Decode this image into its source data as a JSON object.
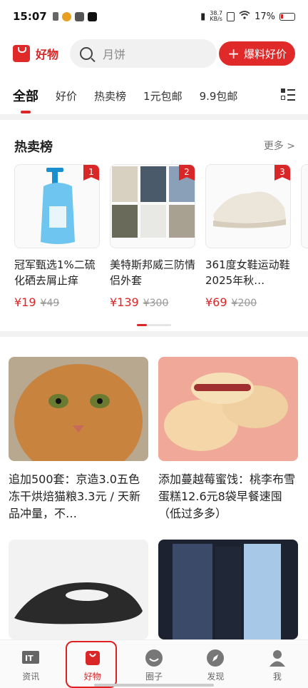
{
  "status": {
    "time": "15:07",
    "speed": "38.7",
    "speed_unit": "KB/s",
    "battery": "17%"
  },
  "header": {
    "logo_text": "好物",
    "search_placeholder": "月饼",
    "tip_button": "爆料好价"
  },
  "tabs": [
    "全部",
    "好价",
    "热卖榜",
    "1元包邮",
    "9.9包邮"
  ],
  "hot": {
    "title": "热卖榜",
    "more": "更多 >",
    "items": [
      {
        "rank": "1",
        "name": "冠军甄选1%二硫化硒去屑止痒",
        "price": "¥19",
        "original_price": "¥49"
      },
      {
        "rank": "2",
        "name": "美特斯邦威三防情侣外套",
        "price": "¥139",
        "original_price": "¥300"
      },
      {
        "rank": "3",
        "name": "361度女鞋运动鞋2025年秋…",
        "price": "¥69",
        "original_price": "¥200"
      }
    ]
  },
  "feed": [
    {
      "text": "追加500套：京造3.0五色冻干烘焙猫粮3.3元 / 天新品冲量，不…"
    },
    {
      "text": "添加蔓越莓蜜饯：桃李布雪蛋糕12.6元8袋早餐速囤（低过多多）"
    }
  ],
  "tabbar": [
    "资讯",
    "好物",
    "圈子",
    "发现",
    "我"
  ],
  "colors": {
    "brand_red": "#d92626"
  }
}
